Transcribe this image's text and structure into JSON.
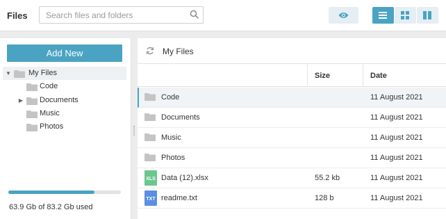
{
  "header": {
    "title": "Files",
    "search_placeholder": "Search files and folders"
  },
  "sidebar": {
    "add_new_label": "Add New",
    "tree": [
      {
        "label": "My Files",
        "level": 0,
        "expanded": true,
        "selected": true
      },
      {
        "label": "Code",
        "level": 1
      },
      {
        "label": "Documents",
        "level": 1,
        "has_children": true
      },
      {
        "label": "Music",
        "level": 1
      },
      {
        "label": "Photos",
        "level": 1
      }
    ],
    "storage": {
      "used_fraction": 0.768,
      "text": "63.9 Gb of 83.2 Gb used"
    }
  },
  "main": {
    "path": "My Files",
    "columns": {
      "size": "Size",
      "date": "Date"
    },
    "rows": [
      {
        "name": "Code",
        "type": "folder",
        "size": "",
        "date": "11 August 2021"
      },
      {
        "name": "Documents",
        "type": "folder",
        "size": "",
        "date": "11 August 2021"
      },
      {
        "name": "Music",
        "type": "folder",
        "size": "",
        "date": "11 August 2021"
      },
      {
        "name": "Photos",
        "type": "folder",
        "size": "",
        "date": "11 August 2021"
      },
      {
        "name": "Data (12).xlsx",
        "type": "xls",
        "tag": "XLS",
        "size": "55.2 kb",
        "date": "11 August 2021"
      },
      {
        "name": "readme.txt",
        "type": "txt",
        "tag": "TXT",
        "size": "128 b",
        "date": "11 August 2021"
      }
    ]
  },
  "colors": {
    "accent": "#4aa3c2",
    "folder": "#c4c4c4",
    "xls": "#6cc68d",
    "txt": "#5b8fe0"
  }
}
